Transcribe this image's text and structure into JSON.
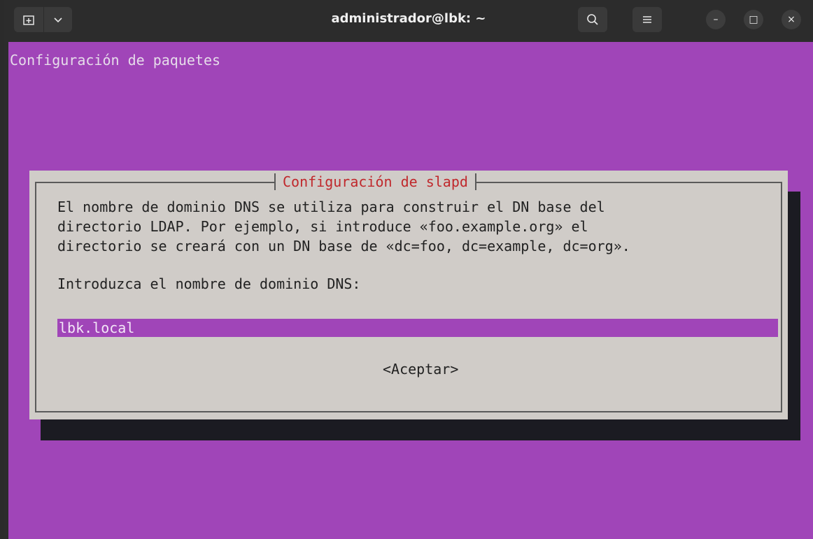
{
  "titlebar": {
    "title": "administrador@lbk: ~",
    "new_tab_icon": "new-tab-icon",
    "dropdown_icon": "chevron-down-icon",
    "search_icon": "search-icon",
    "menu_icon": "hamburger-menu-icon",
    "minimize_glyph": "–",
    "maximize_glyph": "□",
    "close_glyph": "×"
  },
  "terminal": {
    "background_color": "#a045b8",
    "header": "Configuración de paquetes"
  },
  "dialog": {
    "title": "Configuración de slapd",
    "description": "El nombre de dominio DNS se utiliza para construir el DN base del\ndirectorio LDAP. Por ejemplo, si introduce «foo.example.org» el\ndirectorio se creará con un DN base de «dc=foo, dc=example, dc=org».",
    "prompt": "Introduzca el nombre de dominio DNS:",
    "input_value": "lbk.local",
    "accept_label": "<Aceptar>"
  }
}
